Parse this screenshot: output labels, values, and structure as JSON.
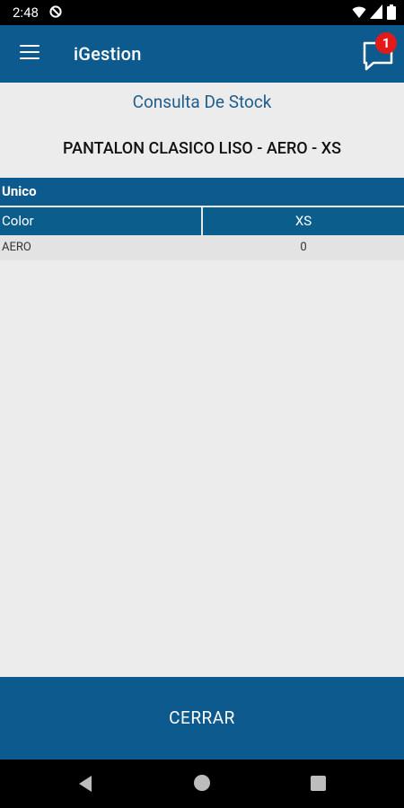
{
  "status_bar": {
    "time": "2:48",
    "icons": [
      "do-not-disturb-icon",
      "wifi-icon",
      "cell-signal-icon",
      "battery-icon"
    ]
  },
  "app_bar": {
    "title": "iGestion",
    "notification_count": "1",
    "icons": [
      "menu-icon",
      "chat-icon"
    ]
  },
  "screen": {
    "title": "Consulta De Stock",
    "product": "PANTALON CLASICO LISO - AERO - XS"
  },
  "table": {
    "section_label": "Unico",
    "columns": [
      "Color",
      "XS"
    ],
    "rows": [
      [
        "AERO",
        "0"
      ]
    ]
  },
  "actions": {
    "close_label": "CERRAR"
  },
  "colors": {
    "primary": "#0d5a8e",
    "badge": "#e21a1a",
    "background": "#ececec"
  }
}
